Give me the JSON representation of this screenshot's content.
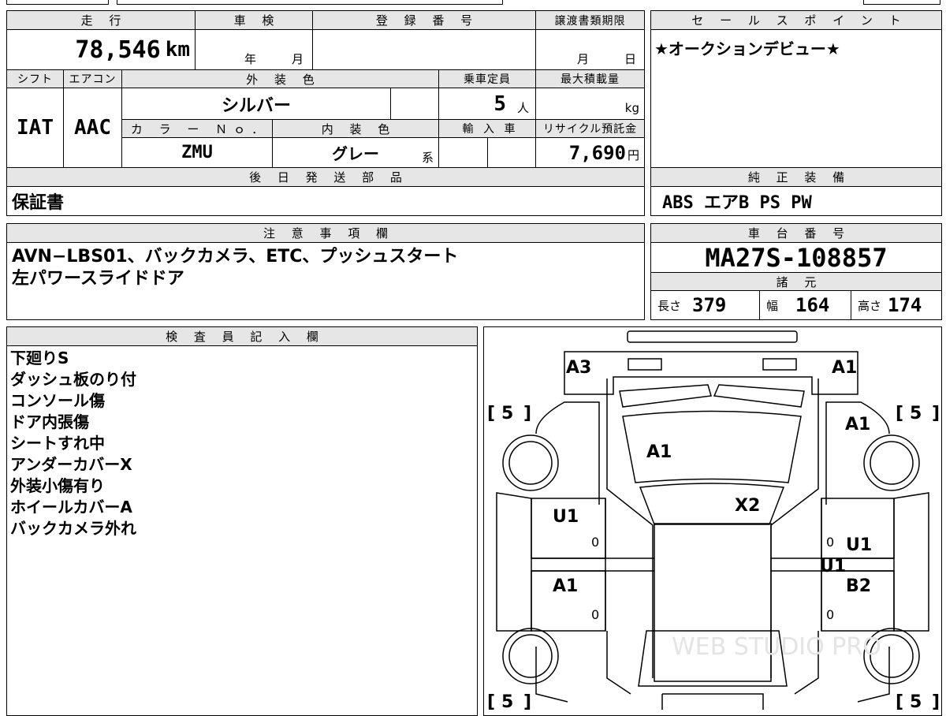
{
  "mileage": {
    "label": "走 行",
    "value": "78,546",
    "unit": "km"
  },
  "shaken": {
    "label": "車 検",
    "year_unit": "年",
    "month_unit": "月"
  },
  "registration": {
    "label": "登 録 番 号"
  },
  "transfer_deadline": {
    "label": "譲渡書類期限",
    "month_unit": "月",
    "day_unit": "日"
  },
  "sales_point": {
    "label": "セ ー ル ス ポ イ ン ト",
    "text": "★オークションデビュー★"
  },
  "shift": {
    "label": "シフト",
    "value": "IAT"
  },
  "aircon": {
    "label": "エアコン",
    "value": "AAC"
  },
  "exterior_color": {
    "label": "外 装 色",
    "value": "シルバー"
  },
  "capacity": {
    "label": "乗車定員",
    "value": "5",
    "unit": "人"
  },
  "max_load": {
    "label": "最大積載量",
    "unit": "kg"
  },
  "color_no": {
    "label": "カ ラ ー Ｎｏ．",
    "value": "ZMU"
  },
  "interior_color": {
    "label": "内 装 色",
    "value": "グレー",
    "suffix": "系"
  },
  "import_car": {
    "label": "輸 入 車"
  },
  "recycle_fee": {
    "label": "リサイクル預託金",
    "value": "7,690",
    "unit": "円"
  },
  "later_parts": {
    "label": "後 日 発 送 部 品",
    "value": "保証書"
  },
  "genuine_equipment": {
    "label": "純 正 装 備",
    "value": "ABS エアB PS PW"
  },
  "remarks": {
    "label": "注 意 事 項 欄",
    "lines": [
      "AVN−LBS01、バックカメラ、ETC、プッシュスタート",
      "左パワースライドドア"
    ]
  },
  "chassis_number": {
    "label": "車 台 番 号",
    "value": "MA27S-108857"
  },
  "specs": {
    "label": "諸 元",
    "length": {
      "label": "長さ",
      "value": "379"
    },
    "width": {
      "label": "幅",
      "value": "164"
    },
    "height": {
      "label": "高さ",
      "value": "174"
    }
  },
  "inspector": {
    "label": "検 査 員 記 入 欄",
    "notes": [
      "下廻りS",
      "ダッシュ板のり付",
      "コンソール傷",
      "ドア内張傷",
      "シートすれ中",
      "アンダーカバーX",
      "外装小傷有り",
      "ホイールカバーA",
      "バックカメラ外れ"
    ]
  },
  "diagram": {
    "codes": {
      "front_left": "A3",
      "front_right": "A1",
      "right_front_fender": "A1",
      "hood": "A1",
      "roof": "X2",
      "left_front_door": "U1",
      "right_front_door": "U1",
      "right_center": "U1",
      "left_rear_door": "A1",
      "right_rear_door": "B2"
    },
    "tires": {
      "fl": "5",
      "fr": "5",
      "rl": "5",
      "rr": "5"
    },
    "small_marks": [
      "0",
      "0",
      "0",
      "0"
    ],
    "watermark": "WEB STUDIO PRO"
  }
}
